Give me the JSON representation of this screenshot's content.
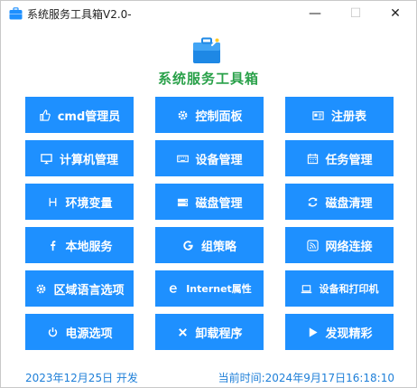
{
  "window": {
    "title": "系统服务工具箱V2.0-",
    "min_glyph": "—",
    "max_glyph": "☐",
    "close_glyph": "✕"
  },
  "header": {
    "heading": "系统服务工具箱"
  },
  "buttons": [
    {
      "label": "cmd管理员",
      "icon": "thumbs-up-icon"
    },
    {
      "label": "控制面板",
      "icon": "gear-icon"
    },
    {
      "label": "注册表",
      "icon": "id-card-icon"
    },
    {
      "label": "计算机管理",
      "icon": "monitor-icon"
    },
    {
      "label": "设备管理",
      "icon": "keyboard-icon"
    },
    {
      "label": "任务管理",
      "icon": "calendar-icon"
    },
    {
      "label": "环境变量",
      "icon": "h-icon"
    },
    {
      "label": "磁盘管理",
      "icon": "disk-icon"
    },
    {
      "label": "磁盘清理",
      "icon": "refresh-icon"
    },
    {
      "label": "本地服务",
      "icon": "facebook-icon"
    },
    {
      "label": "组策略",
      "icon": "google-icon"
    },
    {
      "label": "网络连接",
      "icon": "rss-icon"
    },
    {
      "label": "区域语言选项",
      "icon": "gear-icon"
    },
    {
      "label": "Internet属性",
      "icon": "ie-icon"
    },
    {
      "label": "设备和打印机",
      "icon": "laptop-icon"
    },
    {
      "label": "电源选项",
      "icon": "power-icon"
    },
    {
      "label": "卸载程序",
      "icon": "close-icon"
    },
    {
      "label": "发现精彩",
      "icon": "play-icon"
    }
  ],
  "footer": {
    "date_dev": "2023年12月25日 开发",
    "time_label": "当前时间:",
    "time_value": "2024年9月17日16:18:10"
  },
  "colors": {
    "button_bg": "#1e90ff",
    "heading": "#2aa14a",
    "footer_text": "#1e7fd8"
  }
}
